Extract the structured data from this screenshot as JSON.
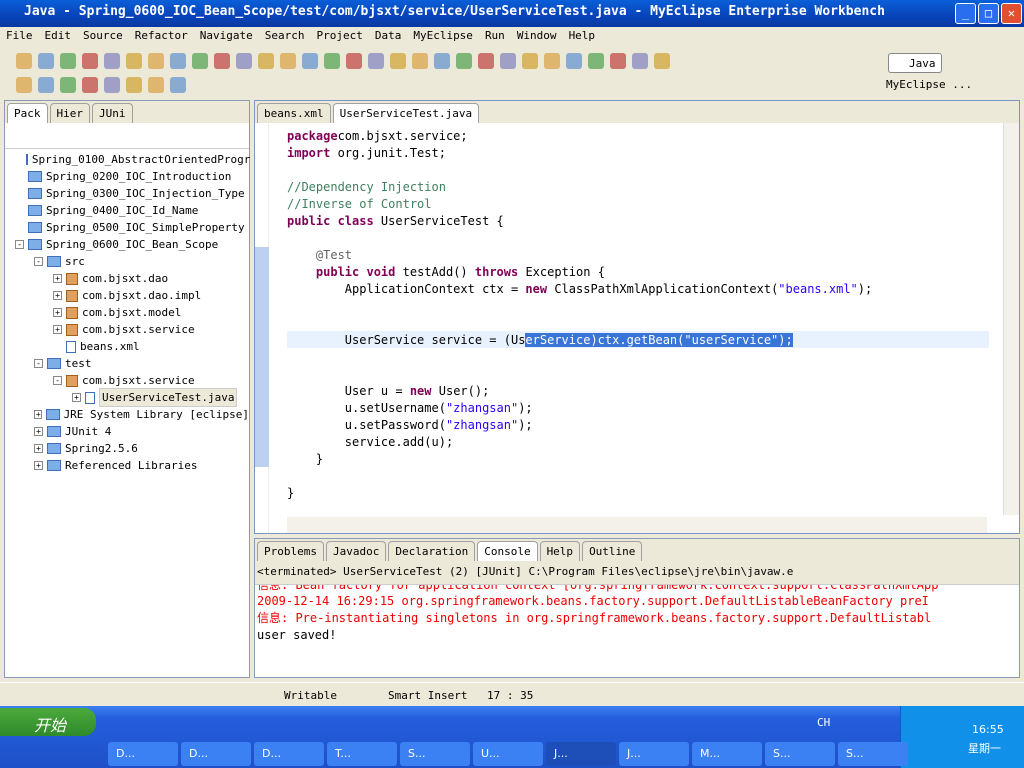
{
  "window": {
    "title": "Java - Spring_0600_IOC_Bean_Scope/test/com/bjsxt/service/UserServiceTest.java - MyEclipse Enterprise Workbench",
    "minimize": "_",
    "maximize": "□",
    "close": "✕"
  },
  "menu": [
    "File",
    "Edit",
    "Source",
    "Refactor",
    "Navigate",
    "Search",
    "Project",
    "Data",
    "MyEclipse",
    "Run",
    "Window",
    "Help"
  ],
  "perspectives": {
    "java": "Java",
    "myeclipse": "MyEclipse ..."
  },
  "left_tabs": [
    "Pack",
    "Hier",
    "JUni"
  ],
  "tree": [
    {
      "label": "Spring_0100_AbstractOrientedProgr",
      "indent": 0,
      "icon": "project",
      "exp": ""
    },
    {
      "label": "Spring_0200_IOC_Introduction",
      "indent": 0,
      "icon": "project",
      "exp": ""
    },
    {
      "label": "Spring_0300_IOC_Injection_Type",
      "indent": 0,
      "icon": "project",
      "exp": ""
    },
    {
      "label": "Spring_0400_IOC_Id_Name",
      "indent": 0,
      "icon": "project",
      "exp": ""
    },
    {
      "label": "Spring_0500_IOC_SimpleProperty",
      "indent": 0,
      "icon": "project",
      "exp": ""
    },
    {
      "label": "Spring_0600_IOC_Bean_Scope",
      "indent": 0,
      "icon": "project",
      "exp": "-"
    },
    {
      "label": "src",
      "indent": 1,
      "icon": "folder",
      "exp": "-"
    },
    {
      "label": "com.bjsxt.dao",
      "indent": 2,
      "icon": "package",
      "exp": "+"
    },
    {
      "label": "com.bjsxt.dao.impl",
      "indent": 2,
      "icon": "package",
      "exp": "+"
    },
    {
      "label": "com.bjsxt.model",
      "indent": 2,
      "icon": "package",
      "exp": "+"
    },
    {
      "label": "com.bjsxt.service",
      "indent": 2,
      "icon": "package",
      "exp": "+"
    },
    {
      "label": "beans.xml",
      "indent": 2,
      "icon": "xml",
      "exp": ""
    },
    {
      "label": "test",
      "indent": 1,
      "icon": "folder",
      "exp": "-"
    },
    {
      "label": "com.bjsxt.service",
      "indent": 2,
      "icon": "package",
      "exp": "-"
    },
    {
      "label": "UserServiceTest.java",
      "indent": 3,
      "icon": "java",
      "exp": "+"
    },
    {
      "label": "JRE System Library [eclipse]",
      "indent": 1,
      "icon": "library",
      "exp": "+"
    },
    {
      "label": "JUnit 4",
      "indent": 1,
      "icon": "library",
      "exp": "+"
    },
    {
      "label": "Spring2.5.6",
      "indent": 1,
      "icon": "library",
      "exp": "+"
    },
    {
      "label": "Referenced Libraries",
      "indent": 1,
      "icon": "library",
      "exp": "+"
    }
  ],
  "editor_tabs": [
    {
      "label": "beans.xml",
      "active": false
    },
    {
      "label": "UserServiceTest.java",
      "active": true
    }
  ],
  "code": [
    [
      [
        "kw",
        "package"
      ],
      [
        "",
        "com.bjsxt.service;"
      ]
    ],
    [
      [
        "kw",
        "import"
      ],
      [
        "",
        " org.junit.Test;"
      ]
    ],
    [],
    [
      [
        "cm",
        "//Dependency Injection"
      ]
    ],
    [
      [
        "cm",
        "//Inverse of Control"
      ]
    ],
    [
      [
        "kw",
        "public class"
      ],
      [
        "",
        " UserServiceTest {"
      ]
    ],
    [],
    [
      [
        "",
        "    "
      ],
      [
        "an",
        "@Test"
      ]
    ],
    [
      [
        "",
        "    "
      ],
      [
        "kw",
        "public void"
      ],
      [
        "",
        " testAdd() "
      ],
      [
        "kw",
        "throws"
      ],
      [
        "",
        " Exception {"
      ]
    ],
    [
      [
        "",
        "        ApplicationContext ctx = "
      ],
      [
        "kw",
        "new"
      ],
      [
        "",
        " ClassPathXmlApplicationContext("
      ],
      [
        "st",
        "\"beans.xml\""
      ],
      [
        "",
        ");"
      ]
    ],
    [],
    [],
    [
      [
        "",
        "        UserService service = (Us"
      ],
      [
        "sel",
        "erService)ctx.getBean(\"userService\");"
      ]
    ],
    [],
    [],
    [
      [
        "",
        "        User u = "
      ],
      [
        "kw",
        "new"
      ],
      [
        "",
        " User();"
      ]
    ],
    [
      [
        "",
        "        u.setUsername("
      ],
      [
        "st",
        "\"zhangsan\""
      ],
      [
        "",
        ");"
      ]
    ],
    [
      [
        "",
        "        u.setPassword("
      ],
      [
        "st",
        "\"zhangsan\""
      ],
      [
        "",
        ");"
      ]
    ],
    [
      [
        "",
        "        service.add(u);"
      ]
    ],
    [
      [
        "",
        "    }"
      ]
    ],
    [],
    [
      [
        "",
        "}"
      ]
    ]
  ],
  "bottom_tabs": [
    "Problems",
    "Javadoc",
    "Declaration",
    "Console",
    "Help",
    "Outline"
  ],
  "console": {
    "header": "<terminated> UserServiceTest (2) [JUnit] C:\\Program Files\\eclipse\\jre\\bin\\javaw.e",
    "lines": [
      {
        "text": "信息: Bean factory for application context [org.springframework.context.support.ClassPathXmlApp",
        "color": "red"
      },
      {
        "text": "2009-12-14 16:29:15 org.springframework.beans.factory.support.DefaultListableBeanFactory preI",
        "color": "red"
      },
      {
        "text": "信息: Pre-instantiating singletons in org.springframework.beans.factory.support.DefaultListabl",
        "color": "red"
      },
      {
        "text": "user saved!",
        "color": "black"
      }
    ]
  },
  "status": {
    "writable": "Writable",
    "insert": "Smart Insert",
    "position": "17 : 35"
  },
  "taskbar": {
    "start": "开始",
    "lang": "CH",
    "time": "16:55",
    "day": "星期一",
    "buttons": [
      "D...",
      "D...",
      "D...",
      "T...",
      "S...",
      "U...",
      "J...",
      "J...",
      "M...",
      "S...",
      "S..."
    ]
  }
}
